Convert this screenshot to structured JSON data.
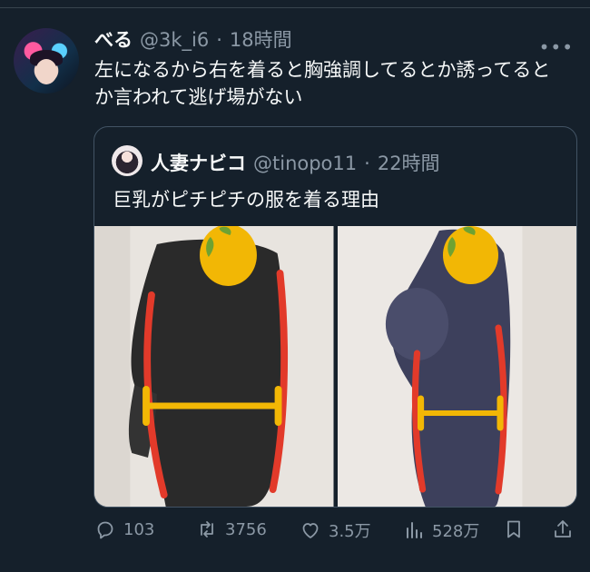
{
  "tweet": {
    "display_name": "べる",
    "handle": "@3k_i6",
    "separator": "·",
    "time": "18時間",
    "text": "左になるから右を着ると胸強調してるとか誘ってるとか言われて逃げ場がない"
  },
  "quoted": {
    "display_name": "人妻ナビコ",
    "handle": "@tinopo11",
    "separator": "·",
    "time": "22時間",
    "text": "巨乳がピチピチの服を着る理由"
  },
  "actions": {
    "replies": "103",
    "retweets": "3756",
    "likes": "3.5万",
    "views": "528万"
  },
  "icons": [
    "more-icon",
    "reply-icon",
    "retweet-icon",
    "like-icon",
    "views-icon",
    "bookmark-icon",
    "share-icon"
  ],
  "colors": {
    "background": "#15202b",
    "text": "#f7f9f9",
    "secondary_text": "#8b98a5",
    "annotation_red": "#e23a2a",
    "annotation_yellow": "#f2b705"
  }
}
